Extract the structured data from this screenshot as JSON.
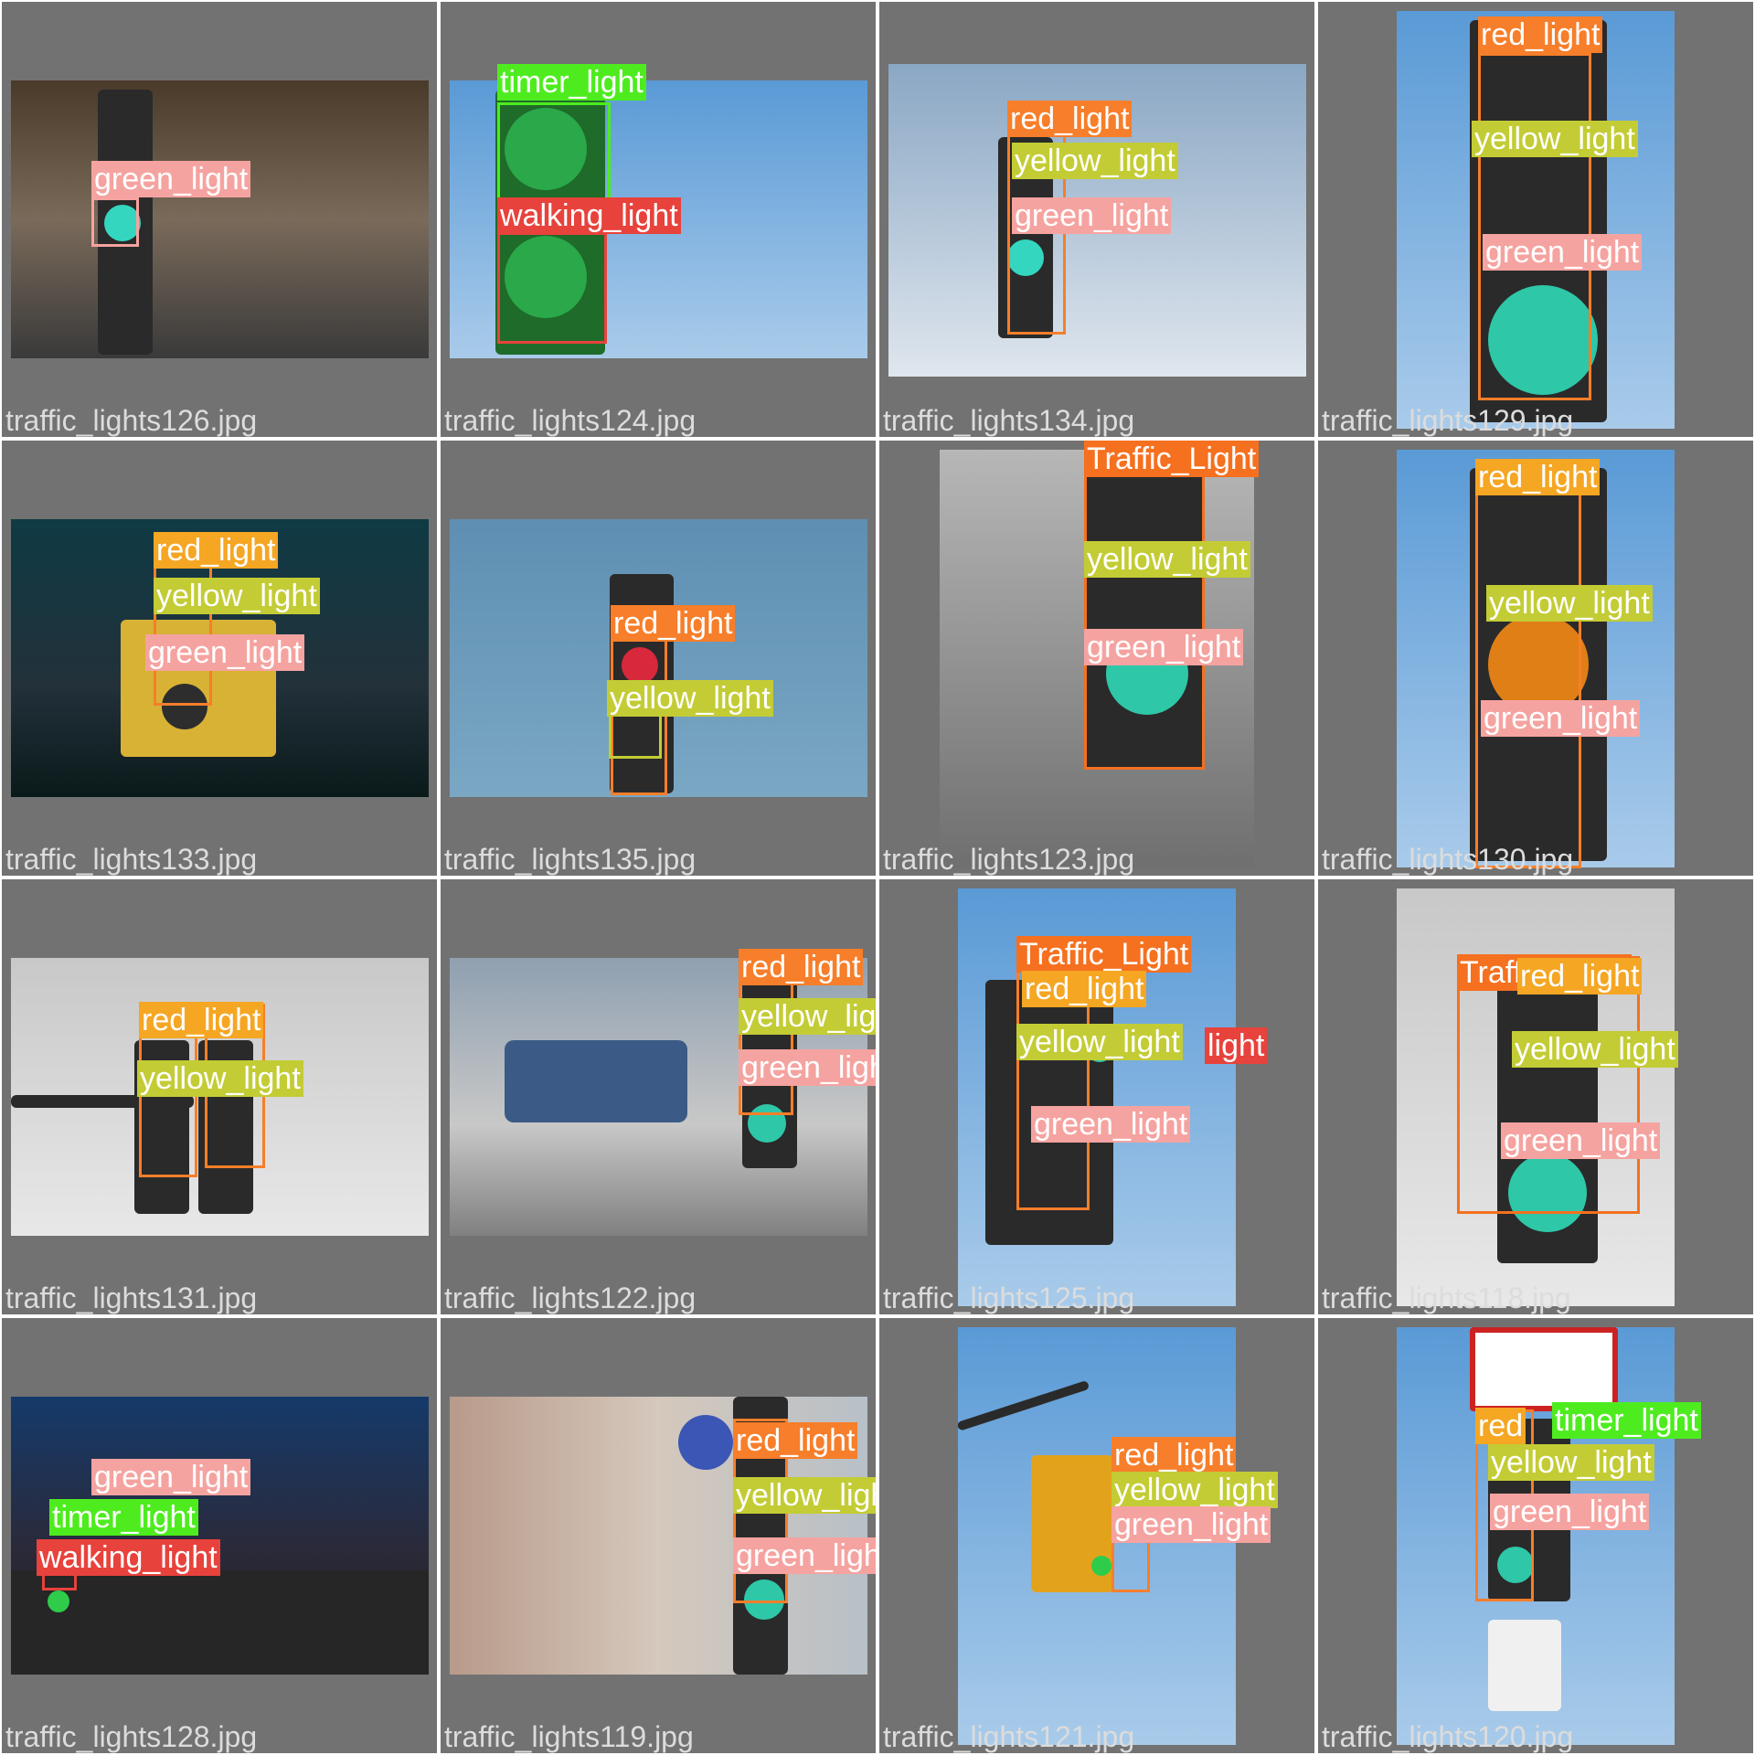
{
  "colors": {
    "red_light": "#f77e2a",
    "yellow_light": "#c3cc35",
    "green_light": "#f5a3a0",
    "timer_light": "#4eec1f",
    "walking_light": "#e8423c",
    "Traffic_Light": "#f5701f",
    "red_light_dup": "#f5a623"
  },
  "tiles": [
    {
      "file": "traffic_lights126.jpg",
      "labels": [
        "green_light"
      ]
    },
    {
      "file": "traffic_lights124.jpg",
      "labels": [
        "timer_light",
        "walking_light"
      ]
    },
    {
      "file": "traffic_lights134.jpg",
      "labels": [
        "red_light",
        "yellow_light",
        "green_light"
      ]
    },
    {
      "file": "traffic_lights129.jpg",
      "labels": [
        "red_light",
        "yellow_light",
        "green_light"
      ]
    },
    {
      "file": "traffic_lights133.jpg",
      "labels": [
        "red_light",
        "yellow_light",
        "green_light"
      ]
    },
    {
      "file": "traffic_lights135.jpg",
      "labels": [
        "red_light",
        "yellow_light"
      ]
    },
    {
      "file": "traffic_lights123.jpg",
      "labels": [
        "Traffic_Light",
        "yellow_light",
        "green_light"
      ]
    },
    {
      "file": "traffic_lights130.jpg",
      "labels": [
        "red_light",
        "yellow_light",
        "green_light"
      ]
    },
    {
      "file": "traffic_lights131.jpg",
      "labels": [
        "red_light",
        "yellow_light"
      ]
    },
    {
      "file": "traffic_lights122.jpg",
      "labels": [
        "red_light",
        "yellow_light",
        "green_light"
      ]
    },
    {
      "file": "traffic_lights125.jpg",
      "labels": [
        "Traffic_Light",
        "red_light",
        "yellow_light",
        "light",
        "green_light"
      ]
    },
    {
      "file": "traffic_lights118.jpg",
      "labels": [
        "Traffic_Light",
        "red_light",
        "yellow_light",
        "green_light"
      ]
    },
    {
      "file": "traffic_lights128.jpg",
      "labels": [
        "green_light",
        "timer_light",
        "walking_light"
      ]
    },
    {
      "file": "traffic_lights119.jpg",
      "labels": [
        "red_light",
        "yellow_light",
        "green_light"
      ]
    },
    {
      "file": "traffic_lights121.jpg",
      "labels": [
        "red_light",
        "yellow_light",
        "green_light"
      ]
    },
    {
      "file": "traffic_lights120.jpg",
      "labels": [
        "red",
        "timer_light",
        "yellow_light",
        "green_light"
      ]
    }
  ]
}
